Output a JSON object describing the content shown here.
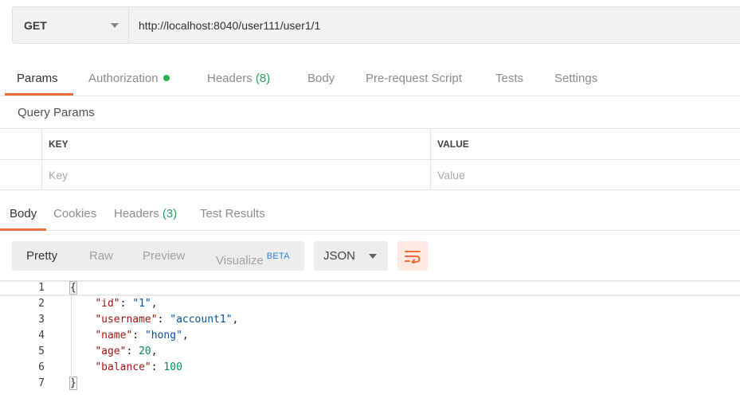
{
  "request": {
    "method": "GET",
    "url": "http://localhost:8040/user111/user1/1"
  },
  "request_tabs": [
    {
      "label": "Params",
      "active": true
    },
    {
      "label": "Authorization",
      "status_dot": true
    },
    {
      "label": "Headers",
      "count": "(8)"
    },
    {
      "label": "Body"
    },
    {
      "label": "Pre-request Script"
    },
    {
      "label": "Tests"
    },
    {
      "label": "Settings"
    }
  ],
  "query_params": {
    "title": "Query Params",
    "columns": [
      "KEY",
      "VALUE"
    ],
    "placeholders": {
      "key": "Key",
      "value": "Value"
    }
  },
  "response_tabs": [
    {
      "label": "Body",
      "active": true
    },
    {
      "label": "Cookies"
    },
    {
      "label": "Headers",
      "count": "(3)"
    },
    {
      "label": "Test Results"
    }
  ],
  "response_toolbar": {
    "views": [
      "Pretty",
      "Raw",
      "Preview",
      "Visualize"
    ],
    "active_view": "Pretty",
    "visualize_badge": "BETA",
    "format": "JSON",
    "wrap_icon": "wrap-lines-icon"
  },
  "response_body": {
    "line_numbers": [
      "1",
      "2",
      "3",
      "4",
      "5",
      "6",
      "7"
    ],
    "json": {
      "id": "1",
      "username": "account1",
      "name": "hong",
      "age": 20,
      "balance": 100
    }
  },
  "colors": {
    "accent": "#f26b3a",
    "count_green": "#26a05e",
    "status_dot": "#26b24b",
    "beta_blue": "#2e7ed6"
  }
}
